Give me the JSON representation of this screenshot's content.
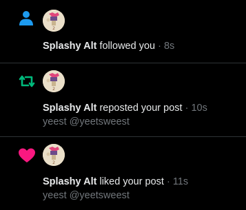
{
  "colors": {
    "background": "#000000",
    "divider": "#2f3336",
    "follow_icon": "#1d9bf0",
    "repost_icon": "#00ba7c",
    "like_icon": "#f91880",
    "muted_text": "#71767b",
    "primary_text": "#e7e9ea"
  },
  "notifications": [
    {
      "icon": "person-icon",
      "user": "Splashy Alt",
      "action": "followed you",
      "separator": "·",
      "time": "8s"
    },
    {
      "icon": "repost-icon",
      "user": "Splashy Alt",
      "action": "reposted your post",
      "separator": "·",
      "time": "10s",
      "post_text": "yeest @yeetsweest"
    },
    {
      "icon": "heart-icon",
      "user": "Splashy Alt",
      "action": "liked your post",
      "separator": "·",
      "time": "11s",
      "post_text": "yeest @yeetsweest"
    }
  ]
}
